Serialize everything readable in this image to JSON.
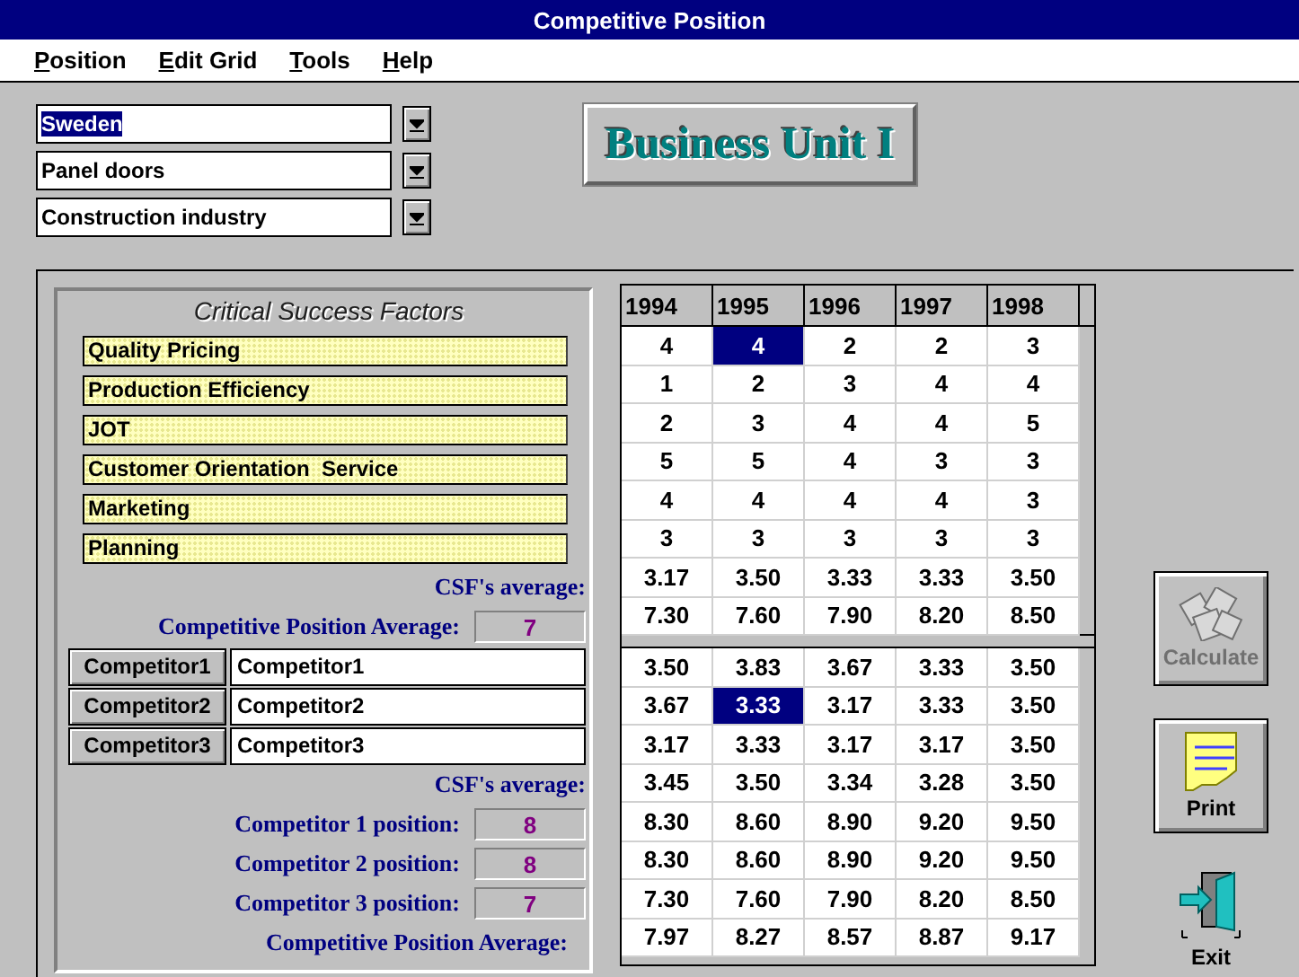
{
  "window": {
    "title": "Competitive Position"
  },
  "menu": [
    {
      "label": "Position"
    },
    {
      "label": "Edit Grid"
    },
    {
      "label": "Tools"
    },
    {
      "label": "Help"
    }
  ],
  "selectors": [
    {
      "value": "Sweden",
      "selected": true
    },
    {
      "value": "Panel doors",
      "selected": false
    },
    {
      "value": "Construction industry",
      "selected": false
    }
  ],
  "unit_banner": "Business Unit I",
  "csf_panel": {
    "title": "Critical Success Factors",
    "factors": [
      "Quality Pricing",
      "Production Efficiency",
      "JOT",
      "Customer Orientation  Service",
      "Marketing",
      "Planning"
    ],
    "csf_average_label": "CSF's average:",
    "position_average_label": "Competitive Position Average:",
    "position_average_value": "7"
  },
  "competitors": {
    "rows": [
      {
        "button": "Competitor1",
        "name": "Competitor1"
      },
      {
        "button": "Competitor2",
        "name": "Competitor2"
      },
      {
        "button": "Competitor3",
        "name": "Competitor3"
      }
    ],
    "csf_average_label": "CSF's average:",
    "positions": [
      {
        "label": "Competitor 1 position:",
        "value": "8"
      },
      {
        "label": "Competitor 2 position:",
        "value": "8"
      },
      {
        "label": "Competitor 3 position:",
        "value": "7"
      }
    ],
    "position_average_label": "Competitive Position Average:"
  },
  "grid": {
    "columns": [
      "1994",
      "1995",
      "1996",
      "1997",
      "1998"
    ],
    "upper_rows": [
      {
        "cells": [
          {
            "text": "4",
            "selected": false
          },
          {
            "text": "4",
            "selected": true
          },
          {
            "text": "2",
            "selected": false
          },
          {
            "text": "2",
            "selected": false
          },
          {
            "text": "3",
            "selected": false
          }
        ]
      },
      {
        "cells": [
          {
            "text": "1",
            "selected": false
          },
          {
            "text": "2",
            "selected": false
          },
          {
            "text": "3",
            "selected": false
          },
          {
            "text": "4",
            "selected": false
          },
          {
            "text": "4",
            "selected": false
          }
        ]
      },
      {
        "cells": [
          {
            "text": "2",
            "selected": false
          },
          {
            "text": "3",
            "selected": false
          },
          {
            "text": "4",
            "selected": false
          },
          {
            "text": "4",
            "selected": false
          },
          {
            "text": "5",
            "selected": false
          }
        ]
      },
      {
        "cells": [
          {
            "text": "5",
            "selected": false
          },
          {
            "text": "5",
            "selected": false
          },
          {
            "text": "4",
            "selected": false
          },
          {
            "text": "3",
            "selected": false
          },
          {
            "text": "3",
            "selected": false
          }
        ]
      },
      {
        "cells": [
          {
            "text": "4",
            "selected": false
          },
          {
            "text": "4",
            "selected": false
          },
          {
            "text": "4",
            "selected": false
          },
          {
            "text": "4",
            "selected": false
          },
          {
            "text": "3",
            "selected": false
          }
        ]
      },
      {
        "cells": [
          {
            "text": "3",
            "selected": false
          },
          {
            "text": "3",
            "selected": false
          },
          {
            "text": "3",
            "selected": false
          },
          {
            "text": "3",
            "selected": false
          },
          {
            "text": "3",
            "selected": false
          }
        ]
      },
      {
        "cells": [
          {
            "text": "3.17",
            "selected": false
          },
          {
            "text": "3.50",
            "selected": false
          },
          {
            "text": "3.33",
            "selected": false
          },
          {
            "text": "3.33",
            "selected": false
          },
          {
            "text": "3.50",
            "selected": false
          }
        ]
      },
      {
        "cells": [
          {
            "text": "7.30",
            "selected": false
          },
          {
            "text": "7.60",
            "selected": false
          },
          {
            "text": "7.90",
            "selected": false
          },
          {
            "text": "8.20",
            "selected": false
          },
          {
            "text": "8.50",
            "selected": false
          }
        ]
      }
    ],
    "lower_rows": [
      {
        "cells": [
          {
            "text": "3.50",
            "selected": false
          },
          {
            "text": "3.83",
            "selected": false
          },
          {
            "text": "3.67",
            "selected": false
          },
          {
            "text": "3.33",
            "selected": false
          },
          {
            "text": "3.50",
            "selected": false
          }
        ]
      },
      {
        "cells": [
          {
            "text": "3.67",
            "selected": false
          },
          {
            "text": "3.33",
            "selected": true
          },
          {
            "text": "3.17",
            "selected": false
          },
          {
            "text": "3.33",
            "selected": false
          },
          {
            "text": "3.50",
            "selected": false
          }
        ]
      },
      {
        "cells": [
          {
            "text": "3.17",
            "selected": false
          },
          {
            "text": "3.33",
            "selected": false
          },
          {
            "text": "3.17",
            "selected": false
          },
          {
            "text": "3.17",
            "selected": false
          },
          {
            "text": "3.50",
            "selected": false
          }
        ]
      },
      {
        "cells": [
          {
            "text": "3.45",
            "selected": false
          },
          {
            "text": "3.50",
            "selected": false
          },
          {
            "text": "3.34",
            "selected": false
          },
          {
            "text": "3.28",
            "selected": false
          },
          {
            "text": "3.50",
            "selected": false
          }
        ]
      },
      {
        "cells": [
          {
            "text": "8.30",
            "selected": false
          },
          {
            "text": "8.60",
            "selected": false
          },
          {
            "text": "8.90",
            "selected": false
          },
          {
            "text": "9.20",
            "selected": false
          },
          {
            "text": "9.50",
            "selected": false
          }
        ]
      },
      {
        "cells": [
          {
            "text": "8.30",
            "selected": false
          },
          {
            "text": "8.60",
            "selected": false
          },
          {
            "text": "8.90",
            "selected": false
          },
          {
            "text": "9.20",
            "selected": false
          },
          {
            "text": "9.50",
            "selected": false
          }
        ]
      },
      {
        "cells": [
          {
            "text": "7.30",
            "selected": false
          },
          {
            "text": "7.60",
            "selected": false
          },
          {
            "text": "7.90",
            "selected": false
          },
          {
            "text": "8.20",
            "selected": false
          },
          {
            "text": "8.50",
            "selected": false
          }
        ]
      },
      {
        "cells": [
          {
            "text": "7.97",
            "selected": false
          },
          {
            "text": "8.27",
            "selected": false
          },
          {
            "text": "8.57",
            "selected": false
          },
          {
            "text": "8.87",
            "selected": false
          },
          {
            "text": "9.17",
            "selected": false
          }
        ]
      }
    ]
  },
  "buttons": [
    {
      "label": "Calculate",
      "kind": "calculate",
      "disabled": true
    },
    {
      "label": "Print",
      "kind": "print",
      "disabled": false
    },
    {
      "label": "Exit",
      "kind": "exit",
      "disabled": false
    }
  ]
}
